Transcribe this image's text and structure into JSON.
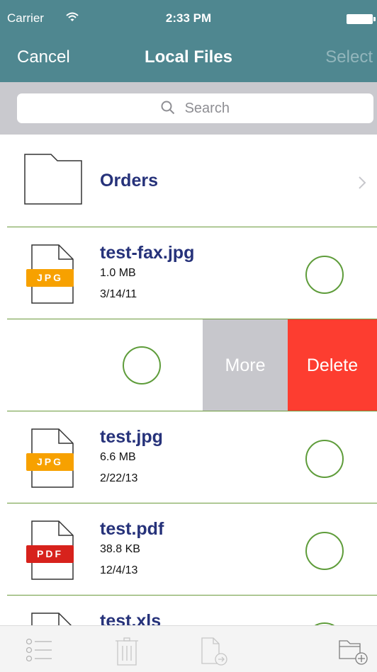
{
  "status_bar": {
    "carrier": "Carrier",
    "time": "2:33 PM"
  },
  "nav": {
    "cancel_label": "Cancel",
    "title": "Local Files",
    "select_label": "Select"
  },
  "search": {
    "placeholder": "Search"
  },
  "folder": {
    "name": "Orders"
  },
  "files": [
    {
      "name": "test-fax.jpg",
      "size": "1.0 MB",
      "date": "3/14/11",
      "type_label": "JPG",
      "badge_color": "#f7a100"
    },
    {
      "name": "test.jpg",
      "size": "6.6 MB",
      "date": "2/22/13",
      "type_label": "JPG",
      "badge_color": "#f7a100"
    },
    {
      "name": "test.pdf",
      "size": "38.8 KB",
      "date": "12/4/13",
      "type_label": "PDF",
      "badge_color": "#d7221c"
    },
    {
      "name": "test.xls"
    }
  ],
  "swipe_actions": {
    "more_label": "More",
    "delete_label": "Delete"
  },
  "toolbar": {
    "icons": [
      "checklist-icon",
      "trash-icon",
      "file-move-icon",
      "new-folder-icon"
    ]
  },
  "colors": {
    "nav_background": "#4f8790",
    "file_name": "#26327a",
    "separator": "#6b9a3c",
    "delete": "#fd3d30",
    "more": "#c7c7cc"
  }
}
